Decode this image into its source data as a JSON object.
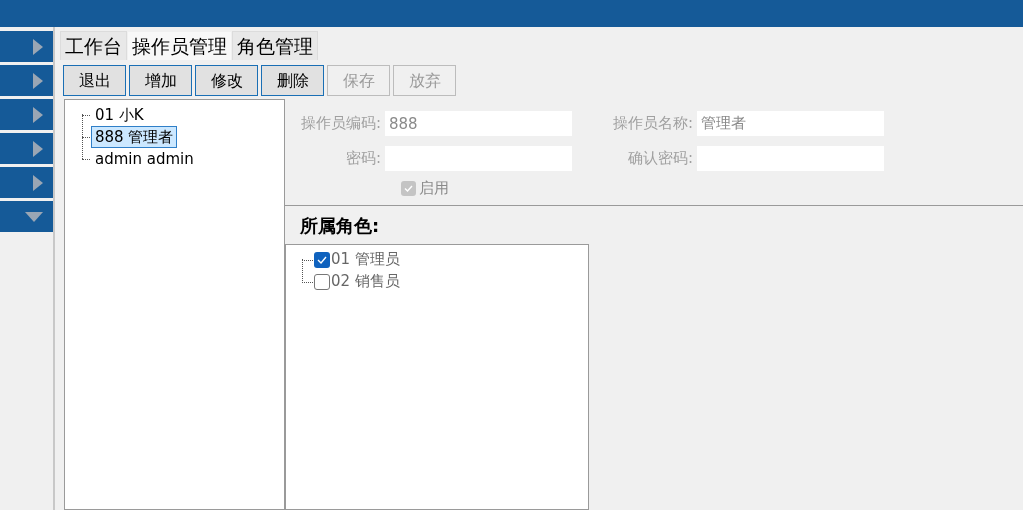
{
  "sidebar": {
    "items": [
      {
        "expanded": false
      },
      {
        "expanded": false
      },
      {
        "expanded": false
      },
      {
        "expanded": false
      },
      {
        "expanded": false
      },
      {
        "expanded": true
      }
    ]
  },
  "tabs": [
    {
      "label": "工作台",
      "selected": false
    },
    {
      "label": "操作员管理",
      "selected": true
    },
    {
      "label": "角色管理",
      "selected": false
    }
  ],
  "toolbar": [
    {
      "label": "退出",
      "disabled": false
    },
    {
      "label": "增加",
      "disabled": false
    },
    {
      "label": "修改",
      "disabled": false
    },
    {
      "label": "删除",
      "disabled": false
    },
    {
      "label": "保存",
      "disabled": true
    },
    {
      "label": "放弃",
      "disabled": true
    }
  ],
  "operators": [
    {
      "label": "01 小K",
      "selected": false
    },
    {
      "label": "888 管理者",
      "selected": true
    },
    {
      "label": "admin admin",
      "selected": false
    }
  ],
  "form": {
    "disabled": true,
    "fields": [
      {
        "label": "操作员编码:",
        "value": "888"
      },
      {
        "label": "操作员名称:",
        "value": "管理者"
      },
      {
        "label": "密码:"
      },
      {
        "label": "确认密码:"
      }
    ],
    "enabled": {
      "label": "启用",
      "checked": true
    }
  },
  "roles": {
    "title": "所属角色:",
    "items": [
      {
        "label": "01 管理员",
        "checked": true
      },
      {
        "label": "02 销售员",
        "checked": false
      }
    ]
  }
}
